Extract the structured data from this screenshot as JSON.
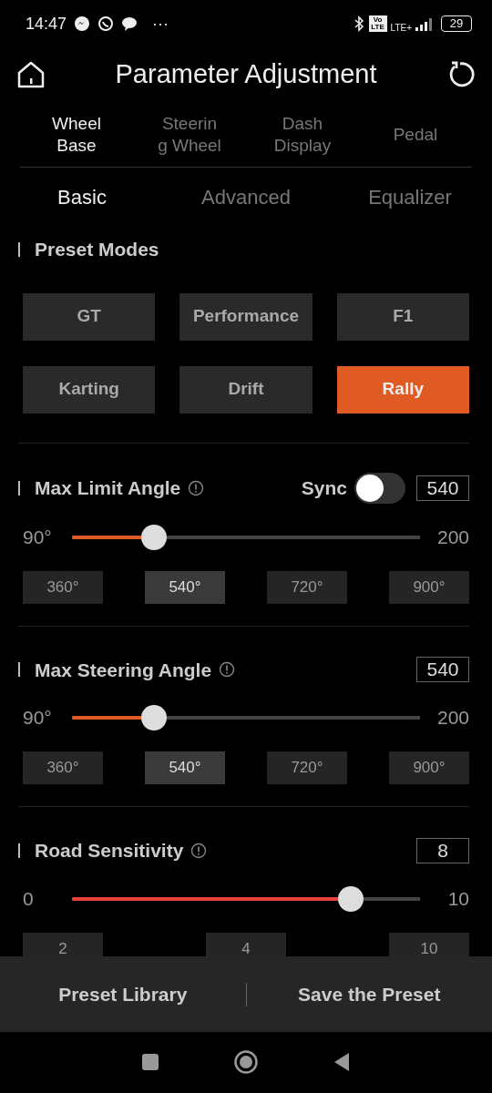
{
  "status_bar": {
    "time": "14:47",
    "more": "···",
    "volte": "Vo LTE",
    "network": "LTE+",
    "battery": "29"
  },
  "header": {
    "title": "Parameter Adjustment"
  },
  "device_tabs": [
    {
      "lines": [
        "Wheel",
        "Base"
      ],
      "selected": true
    },
    {
      "lines": [
        "Steerin",
        "g Wheel"
      ],
      "selected": false
    },
    {
      "lines": [
        "Dash",
        "Display"
      ],
      "selected": false
    },
    {
      "lines": [
        "Pedal"
      ],
      "selected": false
    }
  ],
  "sub_tabs": [
    {
      "label": "Basic",
      "selected": true
    },
    {
      "label": "Advanced",
      "selected": false
    },
    {
      "label": "Equalizer",
      "selected": false
    }
  ],
  "sections": [
    {
      "kind": "presets",
      "title": "Preset Modes",
      "modes": [
        {
          "label": "GT",
          "selected": false
        },
        {
          "label": "Performance",
          "selected": false
        },
        {
          "label": "F1",
          "selected": false
        },
        {
          "label": "Karting",
          "selected": false
        },
        {
          "label": "Drift",
          "selected": false
        },
        {
          "label": "Rally",
          "selected": true
        }
      ]
    },
    {
      "kind": "slider",
      "title": "Max Limit Angle",
      "sync": {
        "label": "Sync",
        "on": false
      },
      "value": "540",
      "min": "90°",
      "max": "200",
      "level": 0.235,
      "color": "#e05a24",
      "chips": [
        {
          "label": "360°",
          "selected": false
        },
        {
          "label": "540°",
          "selected": true
        },
        {
          "label": "720°",
          "selected": false
        },
        {
          "label": "900°",
          "selected": false
        }
      ]
    },
    {
      "kind": "slider",
      "title": "Max Steering Angle",
      "value": "540",
      "min": "90°",
      "max": "200",
      "level": 0.235,
      "color": "#e05a24",
      "chips": [
        {
          "label": "360°",
          "selected": false
        },
        {
          "label": "540°",
          "selected": true
        },
        {
          "label": "720°",
          "selected": false
        },
        {
          "label": "900°",
          "selected": false
        }
      ]
    },
    {
      "kind": "slider",
      "title": "Road Sensitivity",
      "value": "8",
      "min": "0",
      "max": "10",
      "level": 0.8,
      "color": "#e8413c",
      "chips": [
        {
          "label": "2",
          "selected": false
        },
        {
          "label": "4",
          "selected": false
        },
        {
          "label": "10",
          "selected": false
        }
      ]
    }
  ],
  "bottom_bar": {
    "buttons": [
      "Preset Library",
      "Save the Preset"
    ]
  }
}
